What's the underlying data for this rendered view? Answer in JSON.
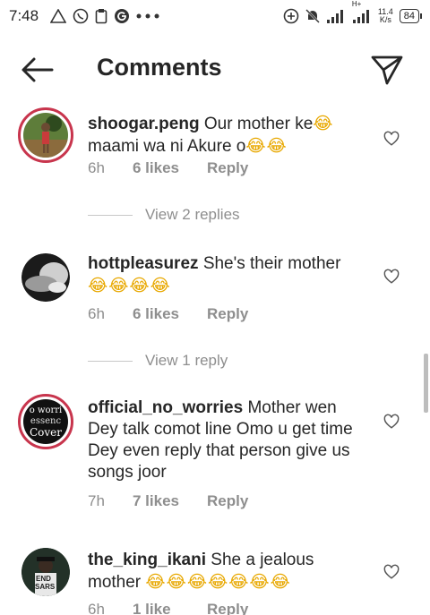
{
  "status_bar": {
    "time": "7:48",
    "net_speed_value": "11.4",
    "net_speed_unit": "K/s",
    "battery": "84",
    "signal_label": "H+"
  },
  "header": {
    "title": "Comments"
  },
  "comments": [
    {
      "username": "shoogar.peng",
      "text": "Our mother ke",
      "emoji_mid": "😂",
      "text2": "maami wa ni Akure o",
      "emoji_end": "😂😂",
      "time": "6h",
      "likes": "6 likes",
      "reply": "Reply",
      "view_replies": "View 2 replies"
    },
    {
      "username": "hottpleasurez",
      "text": "She's their mother",
      "emoji_end": "😂😂😂😂",
      "time": "6h",
      "likes": "6 likes",
      "reply": "Reply",
      "view_replies": "View 1 reply"
    },
    {
      "username": "official_no_worries",
      "text": "Mother wen Dey talk comot line Omo u get time Dey even reply that person give us songs joor",
      "time": "7h",
      "likes": "7 likes",
      "reply": "Reply",
      "avatar_text1": "o worri",
      "avatar_text2": "essenc",
      "avatar_text3": "Cover"
    },
    {
      "username": "the_king_ikani",
      "text": "She a jealous mother",
      "emoji_end": "😂😂😂😂😂😂😂",
      "time": "6h",
      "likes": "1 like",
      "reply": "Reply",
      "avatar_text1": "END",
      "avatar_text2": "SARS"
    }
  ]
}
